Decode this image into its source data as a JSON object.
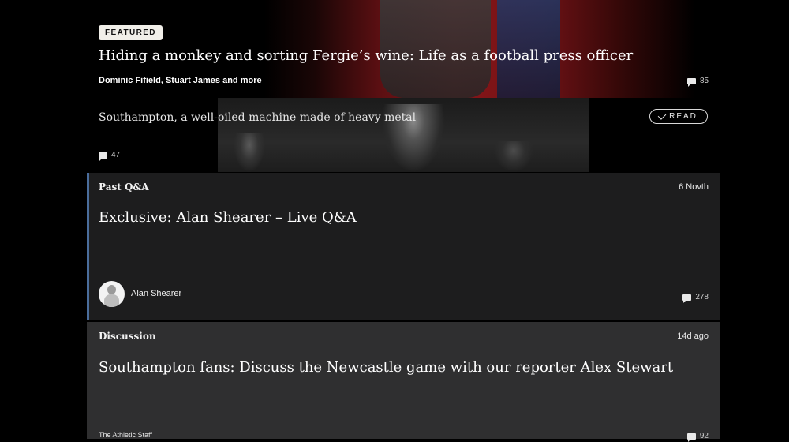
{
  "featured": {
    "badge": "FEATURED",
    "title": "Hiding a monkey and sorting Fergie’s wine: Life as a football press officer",
    "authors": "Dominic Fifield, Stuart James and more",
    "comments": "85"
  },
  "article2": {
    "title": "Southampton, a well-oiled machine made of heavy metal",
    "read_label": "READ",
    "comments": "47"
  },
  "qa_card": {
    "label": "Past Q&A",
    "date": "6 Novth",
    "title": "Exclusive: Alan Shearer – Live Q&A",
    "author": "Alan Shearer",
    "comments": "278"
  },
  "discussion_card": {
    "label": "Discussion",
    "date": "14d ago",
    "title": "Southampton fans: Discuss the Newcastle game with our reporter Alex Stewart",
    "author": "The Athletic Staff",
    "comments": "92"
  },
  "colors": {
    "qa_accent": "#4a6d9c",
    "qa_bg": "#1d1d1e",
    "discussion_bg": "#2f2f30"
  }
}
